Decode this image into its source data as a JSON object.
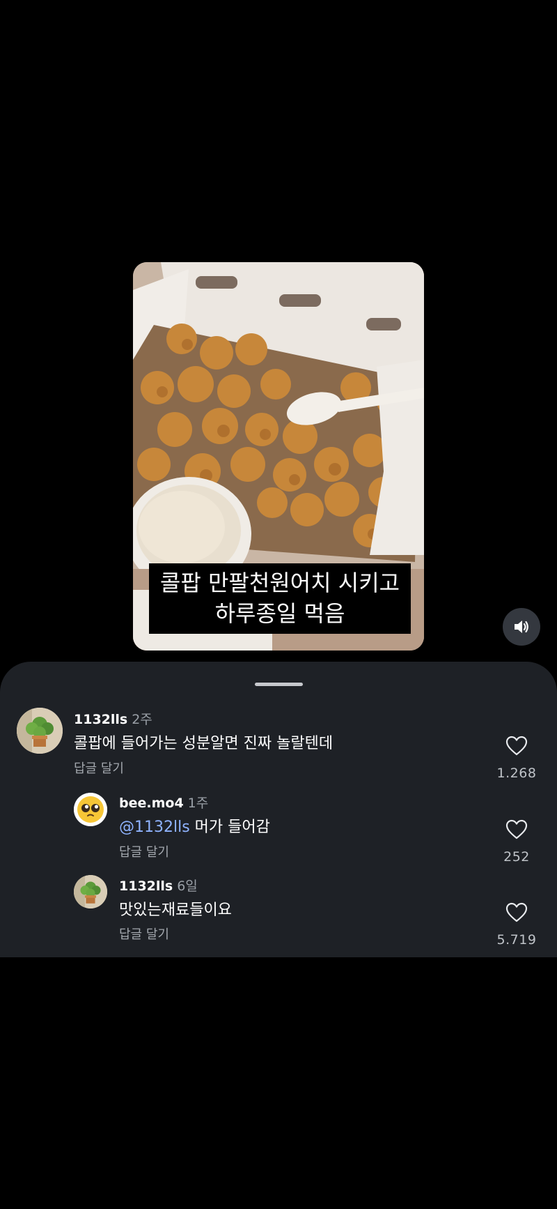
{
  "video": {
    "caption_line1": "콜팝 만팔천원어치 시키고",
    "caption_line2": "하루종일 먹음"
  },
  "comments": [
    {
      "username": "1132lls",
      "time": "2주",
      "text": "콜팝에 들어가는 성분알면 진짜 놀랄텐데",
      "reply": "답글 달기",
      "likes": "1.268"
    },
    {
      "username": "bee.mo4",
      "time": "1주",
      "mention": "@1132lls",
      "text": " 머가 들어감",
      "reply": "답글 달기",
      "likes": "252"
    },
    {
      "username": "1132lls",
      "time": "6일",
      "text": "맛있는재료들이요",
      "reply": "답글 달기",
      "likes": "5.719"
    }
  ],
  "icons": [
    "speaker-icon",
    "heart-icon",
    "plant-avatar",
    "pleading-emoji-avatar"
  ],
  "colors": {
    "background": "#000000",
    "sheet": "#1e2126",
    "mention": "#8fb3ff",
    "secondary_text": "#a3a8ae"
  }
}
